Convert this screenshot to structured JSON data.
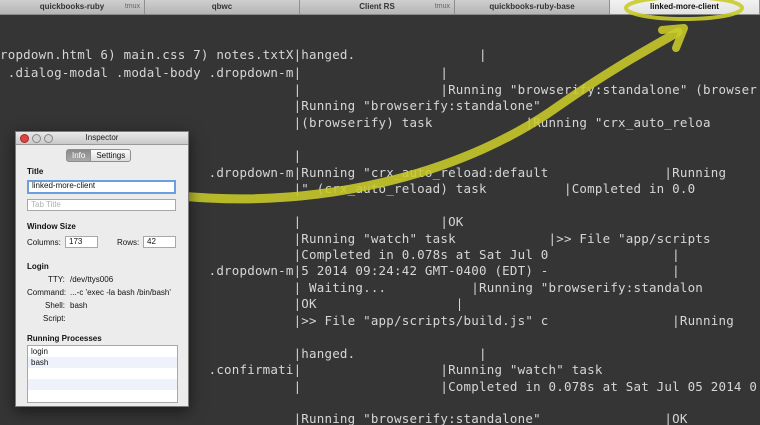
{
  "tabs": [
    {
      "label": "quickbooks-ruby",
      "sub": "tmux"
    },
    {
      "label": "qbwc",
      "sub": ""
    },
    {
      "label": "Client RS",
      "sub": "tmux"
    },
    {
      "label": "quickbooks-ruby-base",
      "sub": ""
    },
    {
      "label": "linked-more-client",
      "sub": ""
    }
  ],
  "terminal": {
    "lines": [
      "ropdown.html 6) main.css 7) notes.txtX|hanged.                |",
      " .dialog-modal .modal-body .dropdown-m|                  |",
      "                                      |                  |Running \"browserify:standalone\" (browser",
      "                                      |Running \"browserify:standalone\"",
      "                                      |(browserify) task            |Running \"crx_auto_reloa",
      "                                      |",
      "                           .dropdown-m|Running \"crx_auto_reload:default               |Running",
      "                                      |\" (crx_auto_reload) task          |Completed in 0.0",
      "                                      |                  |OK",
      "                                      |Running \"watch\" task            |>> File \"app/scripts",
      "                                      |Completed in 0.078s at Sat Jul 0                |",
      "                           .dropdown-m|5 2014 09:24:42 GMT-0400 (EDT) -                |",
      "                                      | Waiting...           |Running \"browserify:standalon",
      "                                      |OK                  |",
      "                                      |>> File \"app/scripts/build.js\" c                |Running",
      "",
      "                                      |hanged.                |",
      "                           .confirmati|                  |Running \"watch\" task",
      "                                      |                  |Completed in 0.078s at Sat Jul 05 2014 0",
      "",
      "                                      |Running \"browserify:standalone\"                |OK"
    ]
  },
  "inspector": {
    "window_title": "Inspector",
    "seg_info": "Info",
    "seg_settings": "Settings",
    "title_heading": "Title",
    "title_value": "linked-more-client",
    "tab_title_placeholder": "Tab Title",
    "window_size_heading": "Window Size",
    "columns_label": "Columns:",
    "columns_value": "173",
    "rows_label": "Rows:",
    "rows_value": "42",
    "login_heading": "Login",
    "tty_label": "TTY:",
    "tty_value": "/dev/ttys006",
    "command_label": "Command:",
    "command_value": "...-c 'exec -la bash /bin/bash'",
    "shell_label": "Shell:",
    "shell_value": "bash",
    "script_label": "Script:",
    "script_value": "",
    "running_heading": "Running Processes",
    "processes": [
      "login",
      "bash"
    ]
  },
  "colors": {
    "annotation": "#c9cc2a",
    "terminal_bg": "#353535",
    "terminal_text": "#d6d6d6",
    "focus_ring": "#6aa0e0"
  }
}
